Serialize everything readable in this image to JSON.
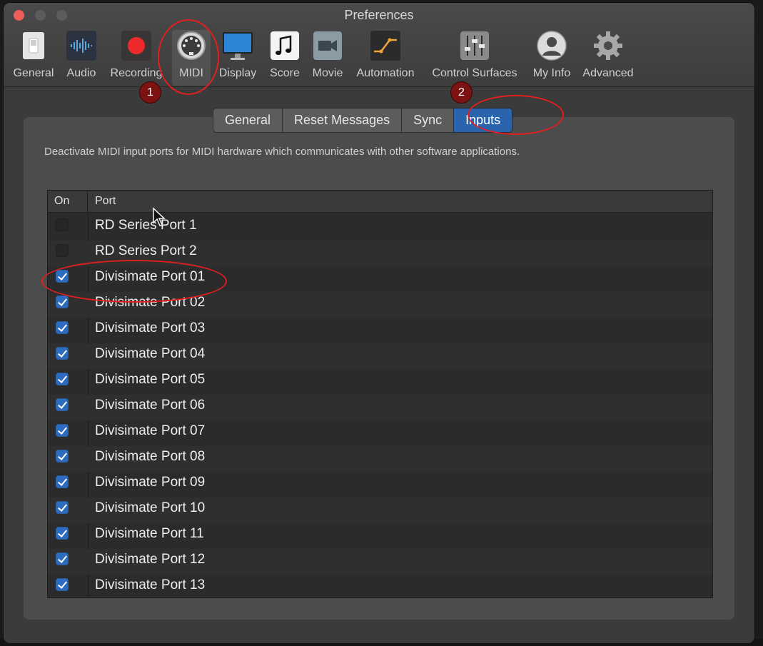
{
  "window": {
    "title": "Preferences"
  },
  "toolbar": {
    "items": [
      {
        "id": "general",
        "label": "General",
        "icon": "light-switch-icon"
      },
      {
        "id": "audio",
        "label": "Audio",
        "icon": "waveform-icon"
      },
      {
        "id": "recording",
        "label": "Recording",
        "icon": "record-icon"
      },
      {
        "id": "midi",
        "label": "MIDI",
        "icon": "midi-connector-icon",
        "selected": true
      },
      {
        "id": "display",
        "label": "Display",
        "icon": "monitor-icon"
      },
      {
        "id": "score",
        "label": "Score",
        "icon": "music-note-icon"
      },
      {
        "id": "movie",
        "label": "Movie",
        "icon": "video-camera-icon"
      },
      {
        "id": "automation",
        "label": "Automation",
        "icon": "automation-curve-icon"
      },
      {
        "id": "control-surfaces",
        "label": "Control Surfaces",
        "icon": "faders-icon"
      },
      {
        "id": "my-info",
        "label": "My Info",
        "icon": "user-silhouette-icon"
      },
      {
        "id": "advanced",
        "label": "Advanced",
        "icon": "gear-icon"
      }
    ]
  },
  "annotations": {
    "marker_1": "1",
    "marker_2": "2"
  },
  "tabs": [
    {
      "id": "general",
      "label": "General"
    },
    {
      "id": "reset-messages",
      "label": "Reset Messages"
    },
    {
      "id": "sync",
      "label": "Sync"
    },
    {
      "id": "inputs",
      "label": "Inputs",
      "active": true
    }
  ],
  "description": "Deactivate MIDI input ports for MIDI hardware which communicates with other software applications.",
  "table": {
    "columns": {
      "on": "On",
      "port": "Port"
    },
    "rows": [
      {
        "port": "RD Series Port 1",
        "on": false
      },
      {
        "port": "RD Series Port 2",
        "on": false
      },
      {
        "port": "Divisimate Port 01",
        "on": true
      },
      {
        "port": "Divisimate Port 02",
        "on": true
      },
      {
        "port": "Divisimate Port 03",
        "on": true
      },
      {
        "port": "Divisimate Port 04",
        "on": true
      },
      {
        "port": "Divisimate Port 05",
        "on": true
      },
      {
        "port": "Divisimate Port 06",
        "on": true
      },
      {
        "port": "Divisimate Port 07",
        "on": true
      },
      {
        "port": "Divisimate Port 08",
        "on": true
      },
      {
        "port": "Divisimate Port 09",
        "on": true
      },
      {
        "port": "Divisimate Port 10",
        "on": true
      },
      {
        "port": "Divisimate Port 11",
        "on": true
      },
      {
        "port": "Divisimate Port 12",
        "on": true
      },
      {
        "port": "Divisimate Port 13",
        "on": true
      }
    ]
  },
  "colors": {
    "accent": "#2a64ad",
    "annotation_red": "#e01f1f",
    "marker_fill": "#7d1212"
  }
}
